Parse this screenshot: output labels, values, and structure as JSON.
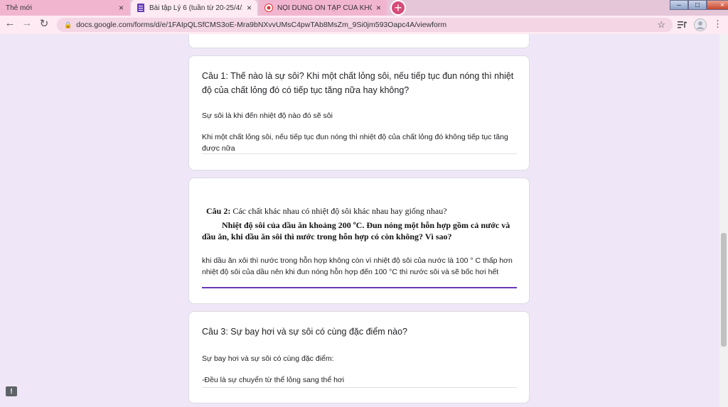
{
  "tabs": [
    {
      "label": "Thẻ mới",
      "close": "×"
    },
    {
      "label": "Bài tập Lý 6 (tuần từ 20-25/4/202",
      "close": "×"
    },
    {
      "label": "NỘI DUNG ÔN TẬP CỦA KHỐI 6",
      "close": "×"
    }
  ],
  "newtab": "+",
  "window": {
    "min": "–",
    "max": "□",
    "close": "×"
  },
  "toolbar": {
    "back": "←",
    "forward": "→",
    "reload": "↻",
    "url": "docs.google.com/forms/d/e/1FAIpQLSfCMS3oE-Mra9bNXvvUMsC4pwTAb8MsZm_9Si0jm593Oapc4A/viewform",
    "star": "☆",
    "lock": "🔒",
    "menu": "⋮"
  },
  "questions": [
    {
      "title": "Câu 1: Thế nào là sự sôi? Khi một chất lỏng sôi, nếu tiếp tục đun nóng thì nhiệt độ của chất lỏng đó có tiếp tục tăng nữa hay không?",
      "answer_line1": "Sự sôi là khi đến nhiệt độ nào đó sẽ sôi",
      "answer_line2": "Khi một chất lỏng sôi, nếu tiếp tục đun nóng thì nhiệt độ của chất lỏng đó không tiếp tục tăng được nữa"
    },
    {
      "title_bold": "Câu 2:",
      "title_rest": " Các chất khác nhau có nhiệt độ sôi khác nhau hay giống nhau?",
      "body": "Nhiệt độ sôi của dầu ăn khoảng 200 ºC. Đun nóng một hỗn hợp gồm cả nước và dầu ăn, khi dầu ăn sôi thì nước trong hỗn hợp có còn không? Vì sao?",
      "answer": "khi dầu ăn xôi thì nước trong hỗn hợp không còn vì nhiệt độ sôi của nước là 100 ° C thấp hơn nhiệt độ sôi của dầu nên khi đun nóng hỗn hợp đến 100 °C thì nước sôi và sẽ bốc hơi hết"
    },
    {
      "title": "Câu 3: Sự bay hơi và sự sôi có cùng đặc điểm nào?",
      "answer_line1": "Sự bay hơi và sự sôi có cùng đặc điểm:",
      "answer_line2": "-Đều là sự chuyển từ thể lỏng sang thể hơi"
    }
  ],
  "feedback_icon": "!"
}
